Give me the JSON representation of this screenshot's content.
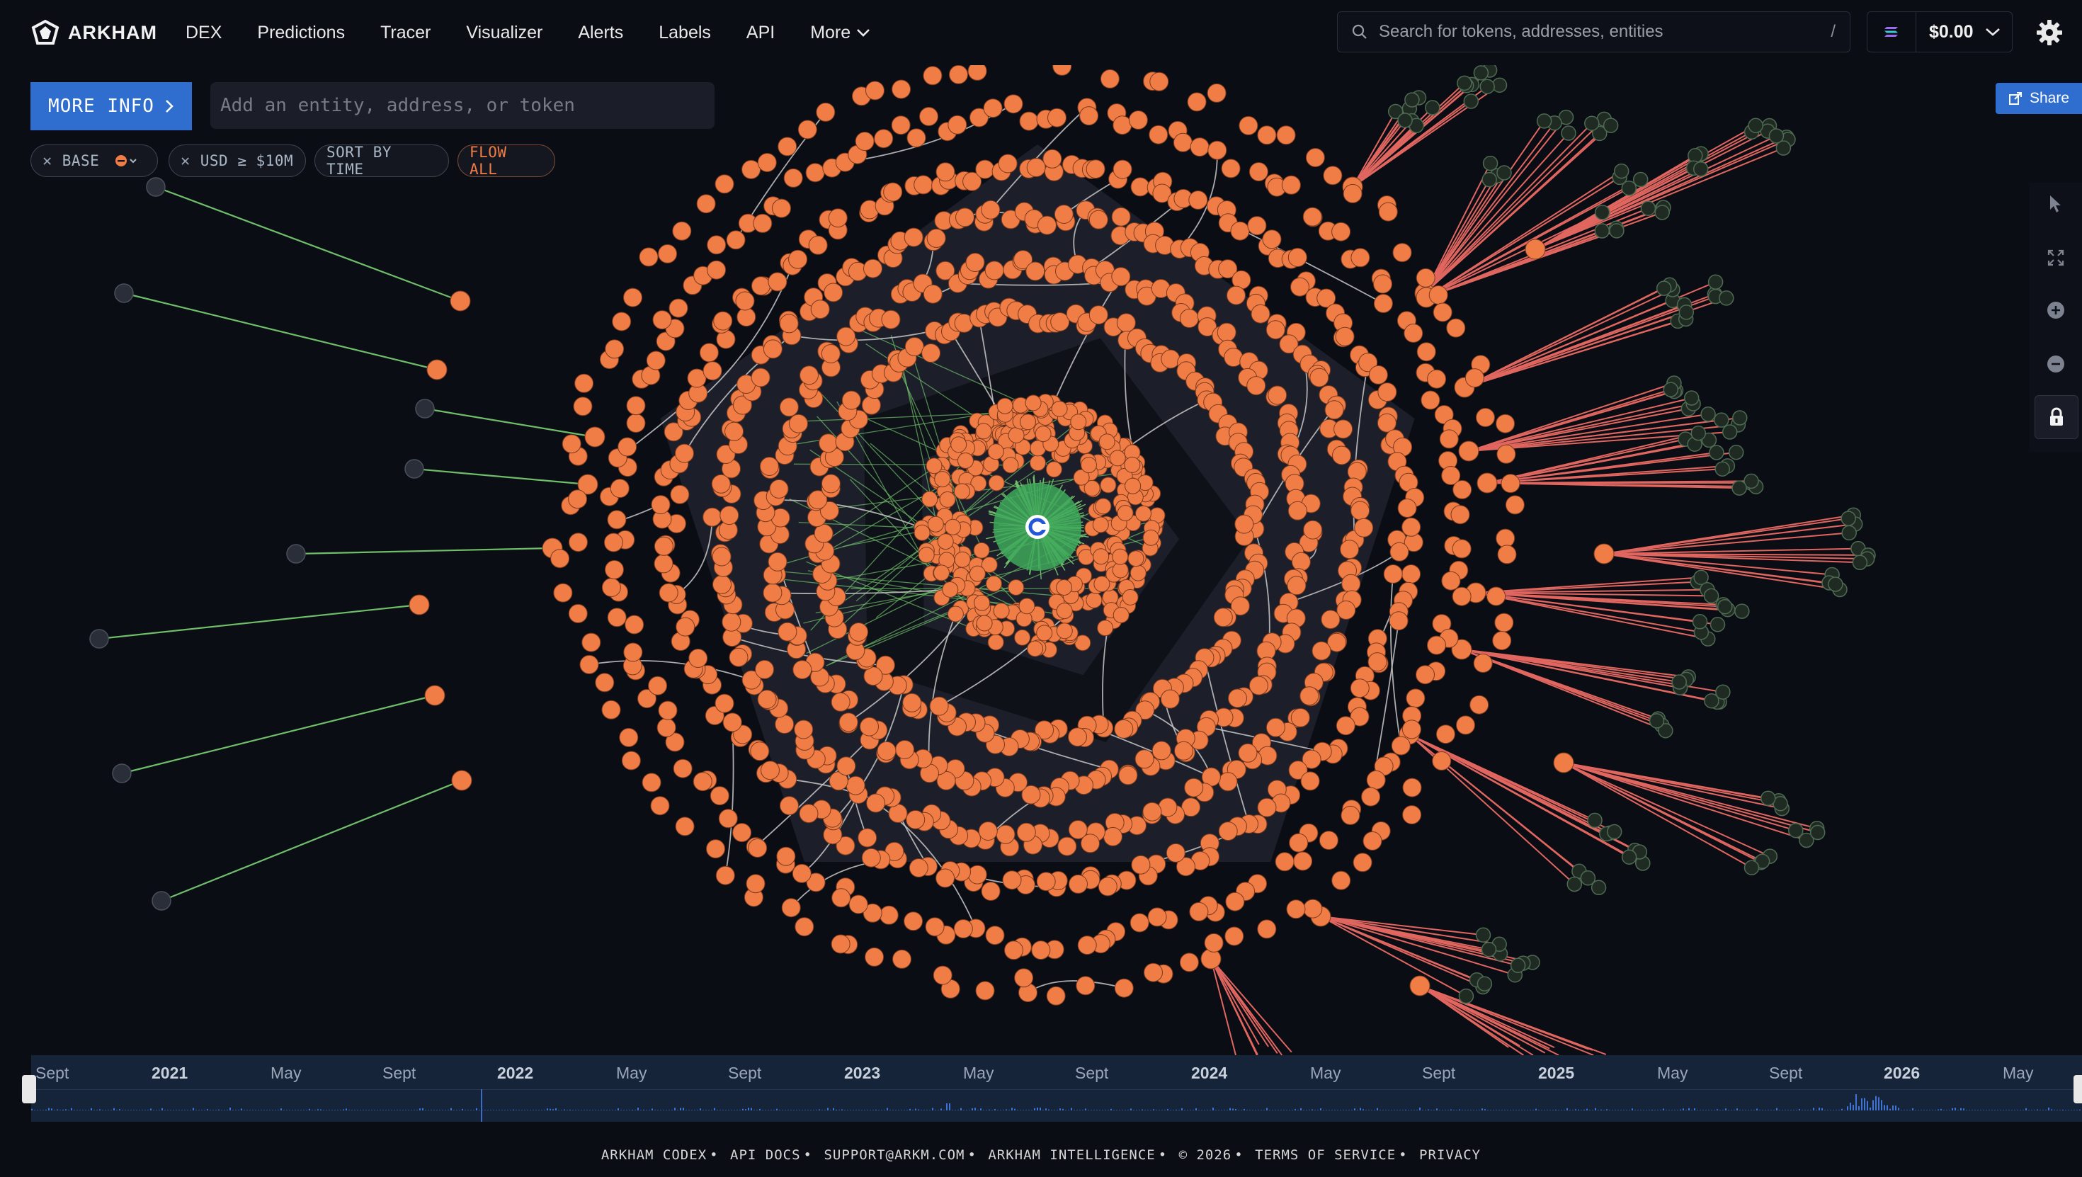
{
  "app": {
    "name": "ARKHAM"
  },
  "nav": {
    "items": [
      "DEX",
      "Predictions",
      "Tracer",
      "Visualizer",
      "Alerts",
      "Labels",
      "API"
    ],
    "more_label": "More"
  },
  "search": {
    "placeholder": "Search for tokens, addresses, entities",
    "shortcut": "/"
  },
  "wallet": {
    "balance": "$0.00"
  },
  "toolbar": {
    "more_info_label": "MORE INFO",
    "entity_placeholder": "Add an entity, address, or token",
    "share_label": "Share",
    "chips": {
      "chain": "BASE",
      "usd": "USD ≥ $10M",
      "sort": "SORT BY TIME",
      "flow": "FLOW ALL"
    }
  },
  "graph": {
    "center_icon": "coinbase-logo",
    "colors": {
      "node": "#f07c46",
      "peripheral_node": "#2a2e38",
      "inflow_edge": "#6fbf6a",
      "outflow_edge": "#e0665f",
      "internal_edge": "#c8c8c8",
      "center": "#3ea85a"
    }
  },
  "timeline": {
    "labels": [
      "Sept",
      "2021",
      "May",
      "Sept",
      "2022",
      "May",
      "Sept",
      "2023",
      "May",
      "Sept",
      "2024",
      "May",
      "Sept",
      "2025",
      "May",
      "Sept",
      "2026",
      "May"
    ]
  },
  "footer": {
    "items": [
      "ARKHAM CODEX",
      "API DOCS",
      "SUPPORT@ARKM.COM",
      "ARKHAM INTELLIGENCE",
      "© 2026",
      "TERMS OF SERVICE",
      "PRIVACY"
    ]
  }
}
